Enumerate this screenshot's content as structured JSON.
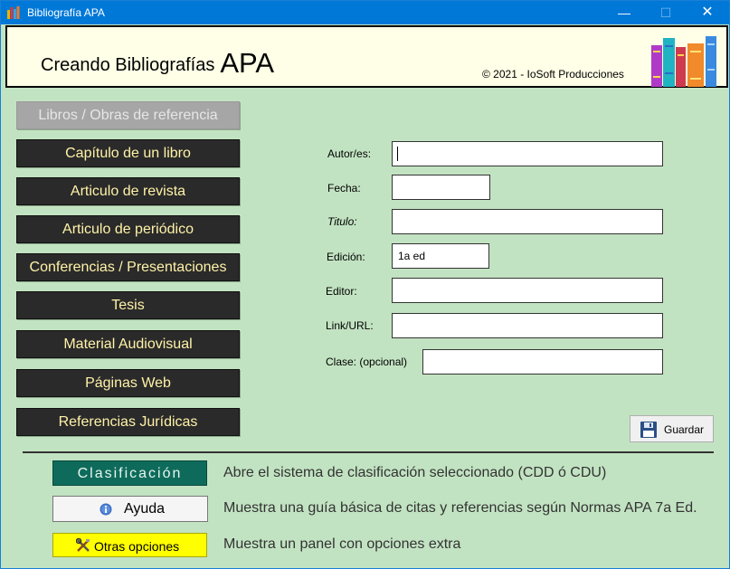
{
  "window": {
    "title": "Bibliografía APA",
    "minimize_glyph": "—",
    "maximize_glyph": "☐",
    "close_glyph": "✕"
  },
  "banner": {
    "title_prefix": "Creando  Bibliografías",
    "title_big": "APA",
    "copyright": "© 2021 - IoSoft Producciones",
    "icon": "books-icon"
  },
  "categories": [
    "Libros / Obras de referencia",
    "Capítulo de un libro",
    "Articulo de revista",
    "Articulo de periódico",
    "Conferencias / Presentaciones",
    "Tesis",
    "Material Audiovisual",
    "Páginas Web",
    "Referencias Jurídicas"
  ],
  "selected_category": "Libros / Obras de referencia",
  "form": {
    "autor_label": "Autor/es:",
    "autor_value": "",
    "fecha_label": "Fecha:",
    "fecha_value": "",
    "titulo_label": "Titulo:",
    "titulo_value": "",
    "edicion_label": "Edición:",
    "edicion_value": "1a ed",
    "editor_label": "Editor:",
    "editor_value": "",
    "link_label": "Link/URL:",
    "link_value": "",
    "clase_label": "Clase: (opcional)",
    "clase_value": ""
  },
  "save_button": {
    "label": "Guardar",
    "icon": "floppy-disk-icon"
  },
  "bottom": {
    "clasificacion_label": "Clasificación",
    "clasificacion_desc": "Abre el sistema de clasificación seleccionado (CDD ó CDU)",
    "ayuda_label": "Ayuda",
    "ayuda_icon": "info-icon",
    "ayuda_desc": "Muestra una guía básica de citas y referencias según Normas APA  7a Ed.",
    "otras_label": "Otras opciones",
    "otras_icon": "tools-icon",
    "otras_desc": "Muestra un panel con opciones extra"
  },
  "colors": {
    "titlebar": "#0078d7",
    "background": "#c2e3c2",
    "category_button": "#2a2a2a",
    "category_text": "#fff2a8",
    "category_selected": "#a6a6a6",
    "clasificacion_button": "#0e6b5b",
    "otras_button": "#ffff00"
  }
}
